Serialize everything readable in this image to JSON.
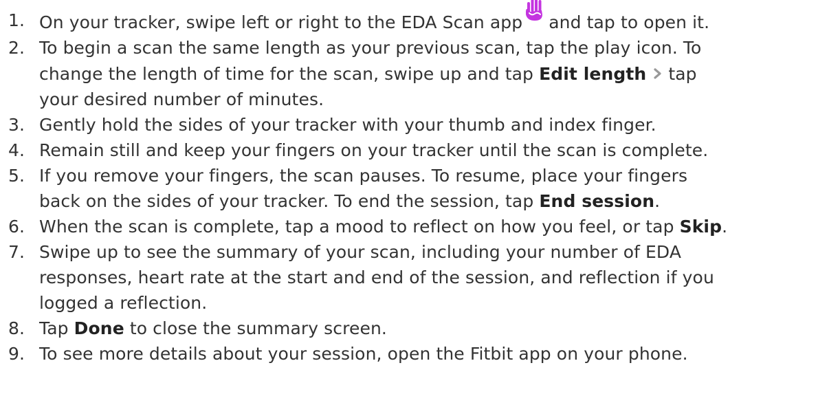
{
  "steps": [
    {
      "num": "1.",
      "t1": "On your tracker, swipe left or right to the EDA Scan app",
      "t2": "and tap to open it."
    },
    {
      "num": "2.",
      "line1": "To begin a scan the same length as your previous scan, tap the play icon. To",
      "t1": "change the length of time for the scan, swipe up and tap",
      "b1": "Edit length",
      "t2": "tap",
      "line3": "your desired number of minutes."
    },
    {
      "num": "3.",
      "line1": "Gently hold the sides of your tracker with your thumb and index finger."
    },
    {
      "num": "4.",
      "line1": "Remain still and keep your fingers on your tracker until the scan is complete."
    },
    {
      "num": "5.",
      "line1": "If you remove your fingers, the scan pauses. To resume, place your fingers",
      "t1": "back on the sides of your tracker. To end the session, tap",
      "b1": "End session",
      "t2": "."
    },
    {
      "num": "6.",
      "t1": "When the scan is complete, tap a mood to reflect on how you feel, or tap",
      "b1": "Skip",
      "t2": "."
    },
    {
      "num": "7.",
      "line1": "Swipe up to see the summary of your scan, including your number of EDA",
      "line2": "responses, heart rate at the start and end of the session, and reflection if you",
      "line3": "logged a reflection."
    },
    {
      "num": "8.",
      "t0": "Tap",
      "b1": "Done",
      "t2": "to close the summary screen."
    },
    {
      "num": "9.",
      "line1": "To see more details about your session, open the Fitbit app on your phone."
    }
  ],
  "icons": {
    "eda_app": "hand-icon",
    "edit_chevron": "chevron-right-icon"
  },
  "colors": {
    "text": "#333333",
    "eda_icon": "#c435e0",
    "chevron": "#999999"
  }
}
